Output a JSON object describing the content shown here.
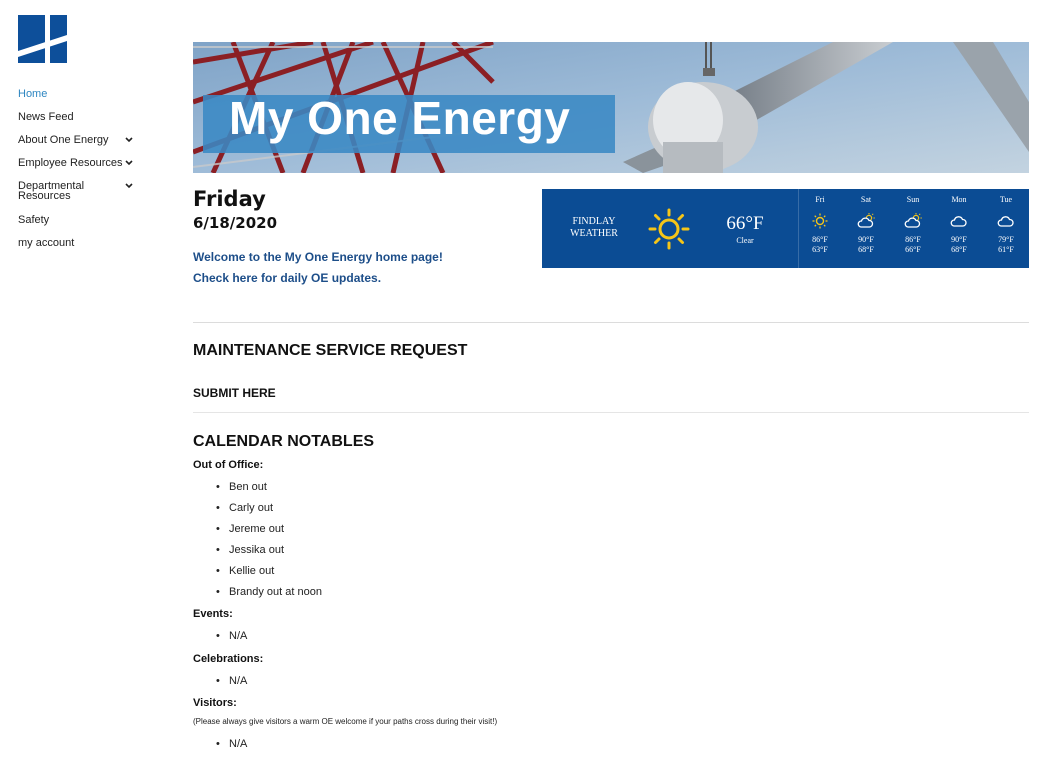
{
  "nav": {
    "home": "Home",
    "news_feed": "News Feed",
    "about": "About One Energy",
    "employee_resources": "Employee Resources",
    "departmental_1": "Departmental",
    "departmental_2": "Resources",
    "safety": "Safety",
    "my_account": "my account"
  },
  "banner": {
    "title": "My One Energy"
  },
  "header": {
    "day": "Friday",
    "date": "6/18/2020",
    "welcome": "Welcome to the My One Energy home page!",
    "daily_link": "Check here for daily OE updates."
  },
  "weather": {
    "city_line1": "FINDLAY",
    "city_line2": "WEATHER",
    "current_temp": "66°F",
    "current_cond": "Clear",
    "current_icon": "sun-icon",
    "forecast": [
      {
        "day": "Fri",
        "icon": "sun-icon",
        "high": "86°F",
        "low": "63°F"
      },
      {
        "day": "Sat",
        "icon": "partly-cloudy-icon",
        "high": "90°F",
        "low": "68°F"
      },
      {
        "day": "Sun",
        "icon": "partly-cloudy-icon",
        "high": "86°F",
        "low": "66°F"
      },
      {
        "day": "Mon",
        "icon": "cloud-icon",
        "high": "90°F",
        "low": "68°F"
      },
      {
        "day": "Tue",
        "icon": "cloud-icon",
        "high": "79°F",
        "low": "61°F"
      }
    ],
    "colors": {
      "background": "#0b4c94",
      "sun": "#f5c518"
    }
  },
  "maintenance": {
    "heading": "MAINTENANCE SERVICE REQUEST",
    "submit": "SUBMIT HERE"
  },
  "calendar": {
    "heading": "CALENDAR NOTABLES",
    "out_label": "Out of Office:",
    "out": [
      "Ben out",
      "Carly out",
      "Jereme out",
      "Jessika out",
      "Kellie out",
      "Brandy out at noon"
    ],
    "events_label": "Events:",
    "events": [
      "N/A"
    ],
    "celebrations_label": "Celebrations:",
    "celebrations": [
      "N/A"
    ],
    "visitors_label": "Visitors:",
    "visitors_note": "(Please always give visitors a warm OE welcome if your paths cross during their visit!)",
    "visitors": [
      "N/A"
    ]
  },
  "colors": {
    "link": "#1d4e89",
    "nav_active": "#2e86c1",
    "brand_blue": "#0b4c94"
  }
}
